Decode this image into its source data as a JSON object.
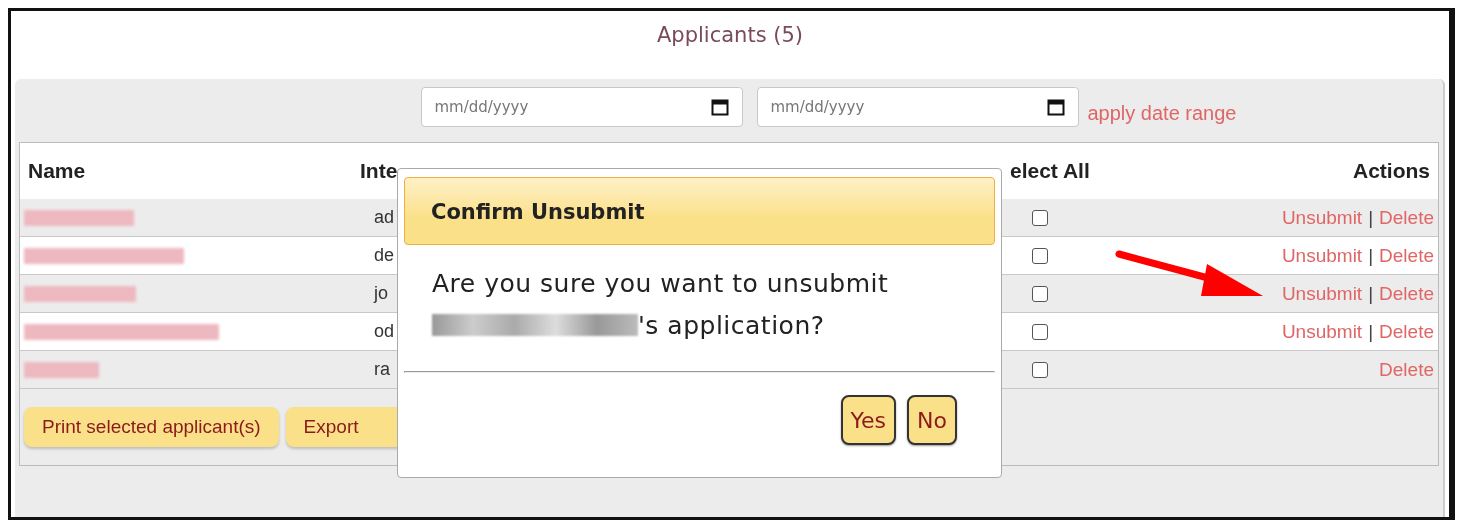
{
  "title": "Applicants (5)",
  "date_range": {
    "from": {
      "placeholder": "mm/dd/yyyy"
    },
    "to": {
      "placeholder": "mm/dd/yyyy"
    },
    "apply_link": "apply date range"
  },
  "table": {
    "columns": [
      "Name",
      "Inte",
      "elect All",
      "Actions"
    ],
    "rows": [
      {
        "ip": "ad",
        "checked": false,
        "actions": [
          {
            "kind": "link",
            "text": "Unsubmit"
          },
          {
            "kind": "separator",
            "text": "|"
          },
          {
            "kind": "link",
            "text": "Delete"
          }
        ]
      },
      {
        "ip": "de",
        "checked": false,
        "actions": [
          {
            "kind": "link",
            "text": "Unsubmit"
          },
          {
            "kind": "separator",
            "text": "|"
          },
          {
            "kind": "link",
            "text": "Delete"
          }
        ]
      },
      {
        "ip": "jo",
        "checked": false,
        "actions": [
          {
            "kind": "link",
            "text": "Unsubmit"
          },
          {
            "kind": "separator",
            "text": "|"
          },
          {
            "kind": "link",
            "text": "Delete"
          }
        ]
      },
      {
        "ip": "od",
        "checked": false,
        "actions": [
          {
            "kind": "link",
            "text": "Unsubmit"
          },
          {
            "kind": "separator",
            "text": "|"
          },
          {
            "kind": "link",
            "text": "Delete"
          }
        ]
      },
      {
        "ip": "ra",
        "checked": false,
        "actions": [
          {
            "kind": "link",
            "text": "Delete"
          }
        ]
      }
    ]
  },
  "buttons": [
    "Print selected applicant(s)",
    "Export"
  ],
  "dialog": {
    "title": "Confirm Unsubmit",
    "message": "Are you sure you want to unsubmit",
    "message_suffix": "'s application?",
    "buttons": [
      "Yes",
      "No"
    ]
  }
}
